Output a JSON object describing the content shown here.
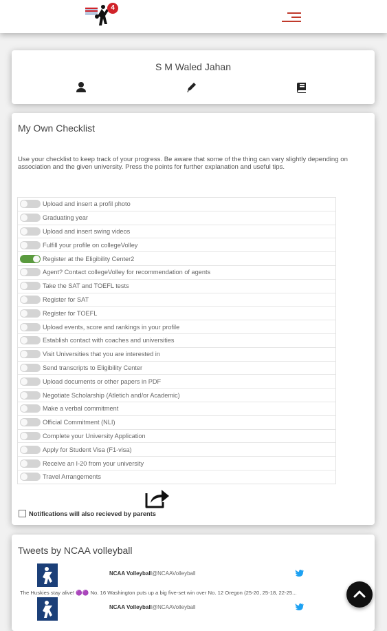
{
  "header": {
    "badge_count": "4",
    "icons": {
      "logo": "volleyball-player-logo-icon",
      "menu": "hamburger-menu-icon"
    },
    "menu_color": "#c0392b"
  },
  "profile": {
    "name": "S M Waled Jahan",
    "icons": [
      "user-icon",
      "pencil-icon",
      "book-icon"
    ]
  },
  "checklist": {
    "title": "My Own Checklist",
    "description": "Use your checklist to keep track of your progress. Be aware that some of the thing can vary slightly depending on association and the given university. Press the points for further explanation and useful tips.",
    "items": [
      {
        "label": "Upload and insert a profil photo",
        "checked": false
      },
      {
        "label": "Graduating year",
        "checked": false
      },
      {
        "label": "Upload and insert swing videos",
        "checked": false
      },
      {
        "label": "Fulfill your profile on collegeVolley",
        "checked": false
      },
      {
        "label": "Register at the Eligibility Center2",
        "checked": true
      },
      {
        "label": "Agent? Contact collegeVolley for recommendation of agents",
        "checked": false
      },
      {
        "label": "Take the SAT and TOEFL tests",
        "checked": false
      },
      {
        "label": "Register for SAT",
        "checked": false
      },
      {
        "label": "Register for TOEFL",
        "checked": false
      },
      {
        "label": "Upload events, score and rankings in your profile",
        "checked": false
      },
      {
        "label": "Establish contact with coaches and universities",
        "checked": false
      },
      {
        "label": "Visit Universities that you are interested in",
        "checked": false
      },
      {
        "label": "Send transcripts to Eligibility Center",
        "checked": false
      },
      {
        "label": "Upload documents or other papers in PDF",
        "checked": false
      },
      {
        "label": "Negotiate Scholarship (Atletich and/or Academic)",
        "checked": false
      },
      {
        "label": "Make a verbal commitment",
        "checked": false
      },
      {
        "label": "Official Commitment (NLI)",
        "checked": false
      },
      {
        "label": "Complete your University Application",
        "checked": false
      },
      {
        "label": "Apply for Student Visa (F1-visa)",
        "checked": false
      },
      {
        "label": "Receive an I-20 from your university",
        "checked": false
      },
      {
        "label": "Travel Arrangements",
        "checked": false
      }
    ],
    "share_icon": "share-icon",
    "notification_label": "Notifications will also recieved by parents",
    "notification_checked": false,
    "toggle_on_color": "#5a9a3e"
  },
  "tweets": {
    "title": "Tweets by NCAA volleyball",
    "items": [
      {
        "name": "NCAA Volleyball",
        "handle": "@NCAAVolleyball",
        "text": "The Huskies stay alive! 🟣🟣 No. 16 Washington puts up a big five-set win over No. 12 Oregon (25-20, 25-18, 22-25..."
      },
      {
        "name": "NCAA Volleyball",
        "handle": "@NCAAVolleyball",
        "text": ""
      }
    ]
  },
  "scroll_top_icon": "chevron-up-icon"
}
